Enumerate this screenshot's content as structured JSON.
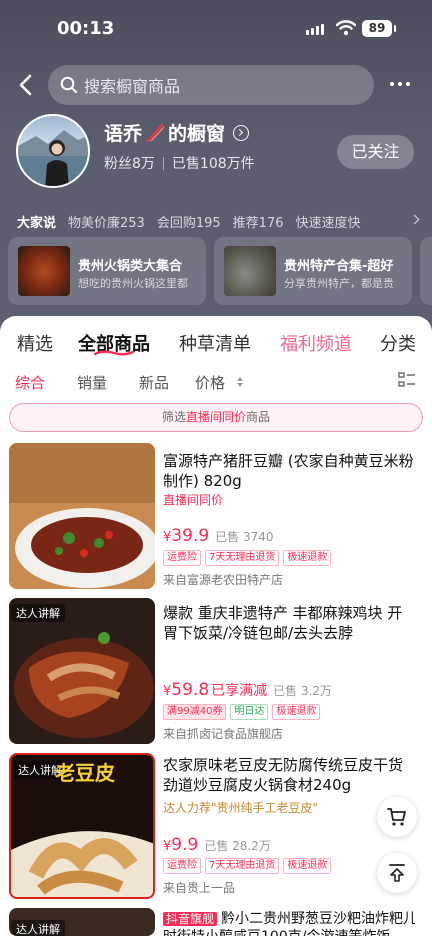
{
  "status": {
    "time": "00:13",
    "battery": "89"
  },
  "search": {
    "placeholder": "搜索橱窗商品"
  },
  "shop": {
    "name": "语乔",
    "name_suffix": "的橱窗",
    "fans": "粉丝8万",
    "sold": "已售108万件",
    "follow_label": "已关注"
  },
  "reviews": {
    "lead": "大家说",
    "items": [
      "物美价廉253",
      "会回购195",
      "推荐176",
      "快速速度快"
    ]
  },
  "collections": [
    {
      "title": "贵州火锅类大集合",
      "desc": "想吃的贵州火锅这里都"
    },
    {
      "title": "贵州特产合集-超好",
      "desc": "分享贵州特产，都是贵"
    }
  ],
  "categories": [
    "精选",
    "全部商品",
    "种草清单",
    "福利频道",
    "分类"
  ],
  "sorts": [
    "综合",
    "销量",
    "新品",
    "价格"
  ],
  "filter": {
    "prefix": "筛选",
    "highlight": "直播间同价",
    "suffix": "商品"
  },
  "products": [
    {
      "title": "富源特产猪肝豆瓣 (农家自种黄豆米粉制作) 820g",
      "subtitle": "直播间同价",
      "price_symbol": "¥",
      "price": "39.9",
      "extra": "",
      "sold": "已售 3740",
      "tags": [
        "运费险",
        "7天无理由退货",
        "极速退款"
      ],
      "from": "来自富源老农田特产店"
    },
    {
      "title": "爆款 重庆非遗特产 丰都麻辣鸡块 开胃下饭菜/冷链包邮/去头去脖",
      "subtitle": "",
      "price_symbol": "¥",
      "price": "59.8",
      "extra": "已享满减",
      "sold": "已售 3.2万",
      "tags": [
        "满99减40券",
        "明日达",
        "极速退款"
      ],
      "from": "来自抓卤记食品旗舰店",
      "badge": "达人讲解"
    },
    {
      "title": "农家原味老豆皮无防腐传统豆皮干货劲道炒豆腐皮火锅食材240g",
      "subtitle": "达人力荐\"贵州纯手工老豆皮\"",
      "price_symbol": "¥",
      "price": "9.9",
      "extra": "",
      "sold": "已售 28.2万",
      "tags": [
        "运费险",
        "7天无理由退货",
        "极速退款"
      ],
      "from": "来自贵上一品",
      "badge": "达人讲解",
      "img_text": "老豆皮"
    },
    {
      "tag_label": "抖音旗舰",
      "title": "黔小二贵州野葱豆沙粑油炸粑儿",
      "title2": "时街特小醇咸豆100克/今游速等炸饭",
      "badge": "达人讲解"
    }
  ],
  "colors": {
    "accent": "#ff2b54",
    "pink_tab": "#f0698a",
    "header_bg": "#555968"
  }
}
